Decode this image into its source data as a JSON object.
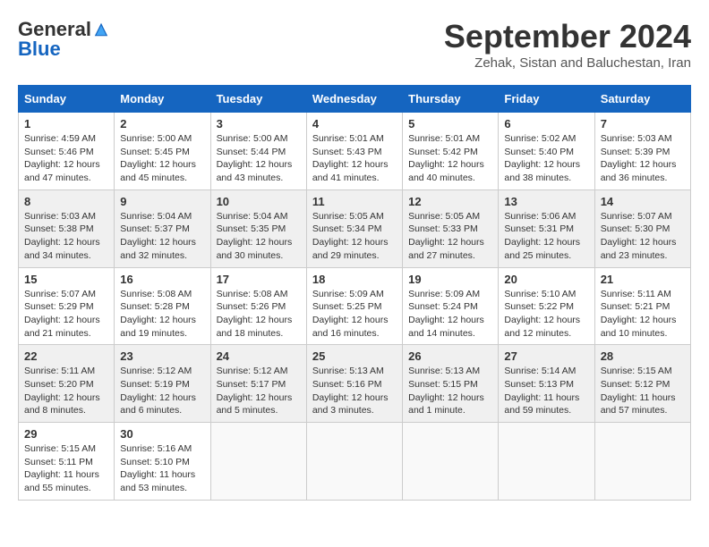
{
  "header": {
    "logo_general": "General",
    "logo_blue": "Blue",
    "month_title": "September 2024",
    "location": "Zehak, Sistan and Baluchestan, Iran"
  },
  "calendar": {
    "days_of_week": [
      "Sunday",
      "Monday",
      "Tuesday",
      "Wednesday",
      "Thursday",
      "Friday",
      "Saturday"
    ],
    "weeks": [
      [
        null,
        {
          "day": "2",
          "sunrise": "5:00 AM",
          "sunset": "5:45 PM",
          "daylight": "12 hours and 45 minutes."
        },
        {
          "day": "3",
          "sunrise": "5:00 AM",
          "sunset": "5:44 PM",
          "daylight": "12 hours and 43 minutes."
        },
        {
          "day": "4",
          "sunrise": "5:01 AM",
          "sunset": "5:43 PM",
          "daylight": "12 hours and 41 minutes."
        },
        {
          "day": "5",
          "sunrise": "5:01 AM",
          "sunset": "5:42 PM",
          "daylight": "12 hours and 40 minutes."
        },
        {
          "day": "6",
          "sunrise": "5:02 AM",
          "sunset": "5:40 PM",
          "daylight": "12 hours and 38 minutes."
        },
        {
          "day": "7",
          "sunrise": "5:03 AM",
          "sunset": "5:39 PM",
          "daylight": "12 hours and 36 minutes."
        }
      ],
      [
        {
          "day": "1",
          "sunrise": "4:59 AM",
          "sunset": "5:46 PM",
          "daylight": "12 hours and 47 minutes."
        },
        {
          "day": "9",
          "sunrise": "5:04 AM",
          "sunset": "5:37 PM",
          "daylight": "12 hours and 32 minutes."
        },
        {
          "day": "10",
          "sunrise": "5:04 AM",
          "sunset": "5:35 PM",
          "daylight": "12 hours and 30 minutes."
        },
        {
          "day": "11",
          "sunrise": "5:05 AM",
          "sunset": "5:34 PM",
          "daylight": "12 hours and 29 minutes."
        },
        {
          "day": "12",
          "sunrise": "5:05 AM",
          "sunset": "5:33 PM",
          "daylight": "12 hours and 27 minutes."
        },
        {
          "day": "13",
          "sunrise": "5:06 AM",
          "sunset": "5:31 PM",
          "daylight": "12 hours and 25 minutes."
        },
        {
          "day": "14",
          "sunrise": "5:07 AM",
          "sunset": "5:30 PM",
          "daylight": "12 hours and 23 minutes."
        }
      ],
      [
        {
          "day": "8",
          "sunrise": "5:03 AM",
          "sunset": "5:38 PM",
          "daylight": "12 hours and 34 minutes."
        },
        {
          "day": "16",
          "sunrise": "5:08 AM",
          "sunset": "5:28 PM",
          "daylight": "12 hours and 19 minutes."
        },
        {
          "day": "17",
          "sunrise": "5:08 AM",
          "sunset": "5:26 PM",
          "daylight": "12 hours and 18 minutes."
        },
        {
          "day": "18",
          "sunrise": "5:09 AM",
          "sunset": "5:25 PM",
          "daylight": "12 hours and 16 minutes."
        },
        {
          "day": "19",
          "sunrise": "5:09 AM",
          "sunset": "5:24 PM",
          "daylight": "12 hours and 14 minutes."
        },
        {
          "day": "20",
          "sunrise": "5:10 AM",
          "sunset": "5:22 PM",
          "daylight": "12 hours and 12 minutes."
        },
        {
          "day": "21",
          "sunrise": "5:11 AM",
          "sunset": "5:21 PM",
          "daylight": "12 hours and 10 minutes."
        }
      ],
      [
        {
          "day": "15",
          "sunrise": "5:07 AM",
          "sunset": "5:29 PM",
          "daylight": "12 hours and 21 minutes."
        },
        {
          "day": "23",
          "sunrise": "5:12 AM",
          "sunset": "5:19 PM",
          "daylight": "12 hours and 6 minutes."
        },
        {
          "day": "24",
          "sunrise": "5:12 AM",
          "sunset": "5:17 PM",
          "daylight": "12 hours and 5 minutes."
        },
        {
          "day": "25",
          "sunrise": "5:13 AM",
          "sunset": "5:16 PM",
          "daylight": "12 hours and 3 minutes."
        },
        {
          "day": "26",
          "sunrise": "5:13 AM",
          "sunset": "5:15 PM",
          "daylight": "12 hours and 1 minute."
        },
        {
          "day": "27",
          "sunrise": "5:14 AM",
          "sunset": "5:13 PM",
          "daylight": "11 hours and 59 minutes."
        },
        {
          "day": "28",
          "sunrise": "5:15 AM",
          "sunset": "5:12 PM",
          "daylight": "11 hours and 57 minutes."
        }
      ],
      [
        {
          "day": "22",
          "sunrise": "5:11 AM",
          "sunset": "5:20 PM",
          "daylight": "12 hours and 8 minutes."
        },
        {
          "day": "30",
          "sunrise": "5:16 AM",
          "sunset": "5:10 PM",
          "daylight": "11 hours and 53 minutes."
        },
        null,
        null,
        null,
        null,
        null
      ],
      [
        {
          "day": "29",
          "sunrise": "5:15 AM",
          "sunset": "5:11 PM",
          "daylight": "11 hours and 55 minutes."
        },
        null,
        null,
        null,
        null,
        null,
        null
      ]
    ]
  }
}
